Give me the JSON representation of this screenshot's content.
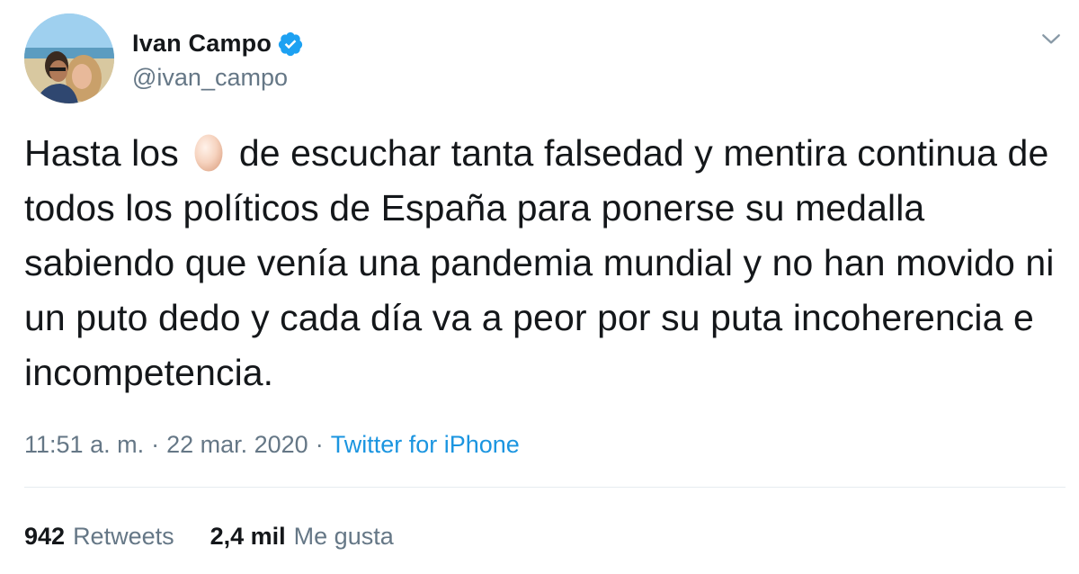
{
  "author": {
    "display_name": "Ivan Campo",
    "handle": "@ivan_campo",
    "verified": true,
    "avatar": "profile-photo"
  },
  "menu_icon": "chevron-down-icon",
  "tweet": {
    "text_before_emoji": "Hasta los",
    "emoji": "egg-emoji",
    "text_after_emoji": "de escuchar tanta falsedad y mentira continua de todos los políticos de España para ponerse su medalla sabiendo que venía una pandemia mundial y no han movido ni un puto dedo y cada día va a peor por su puta incoherencia e incompetencia."
  },
  "meta": {
    "time": "11:51 a. m.",
    "separator": "·",
    "date": "22 mar. 2020",
    "source": "Twitter for iPhone"
  },
  "stats": {
    "retweets_count": "942",
    "retweets_label": "Retweets",
    "likes_count": "2,4 mil",
    "likes_label": "Me gusta"
  },
  "colors": {
    "text": "#14171a",
    "secondary": "#657786",
    "link": "#1b95e0",
    "verified": "#1da1f2",
    "divider": "#e6ecf0"
  }
}
